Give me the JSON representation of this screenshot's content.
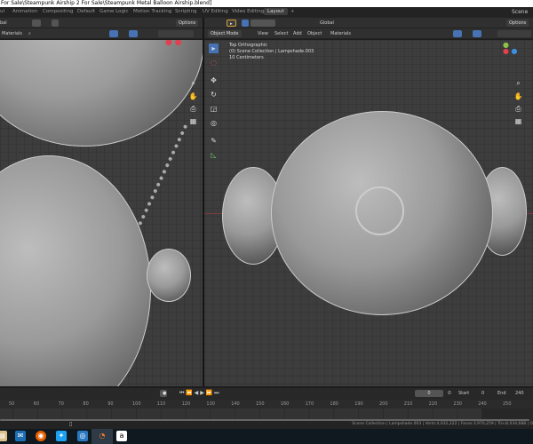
{
  "title": "For Sale\\Steampunk Airship 2 For Sale\\Steampunk Metal Balloon Airship.blend]",
  "workspace_tabs": [
    "ul",
    "Animation",
    "Compositing",
    "Default",
    "Game Logic",
    "Motion Tracking",
    "Scripting",
    "UV Editing",
    "Video Editing",
    "Layout",
    "+"
  ],
  "scene_label": "Scene",
  "left_header": {
    "orientation": "bal",
    "options": "Options",
    "materials": "Materials"
  },
  "right_header": {
    "orientation": "Global",
    "options": "Options",
    "mode": "Object Mode",
    "menus": [
      "View",
      "Select",
      "Add",
      "Object"
    ],
    "materials": "Materials"
  },
  "overlay": {
    "view": "Top Orthographic",
    "collection": "(0) Scene Collection | Lampshade.003",
    "scale": "10 Centimeters"
  },
  "timeline": {
    "current_frame": "0",
    "start_label": "Start",
    "start": "0",
    "end_label": "End",
    "end": "240",
    "ticks": [
      "50",
      "60",
      "70",
      "80",
      "90",
      "100",
      "110",
      "120",
      "130",
      "140",
      "150",
      "160",
      "170",
      "180",
      "190",
      "200",
      "210",
      "220",
      "230",
      "240",
      "250"
    ]
  },
  "status": "Scene Collection | Lampshade.003 | Verts:4,032,222 | Faces:3,970,259 | Tris:8,034,688 | O",
  "taskbar": [
    "store",
    "mail",
    "firefox",
    "twitter",
    "app",
    "blender",
    "amazon"
  ],
  "colors": {
    "accent": "#4772b3",
    "x_axis": "#e0404f",
    "y_axis": "#8bc34a",
    "z_axis": "#3d8fe0"
  }
}
